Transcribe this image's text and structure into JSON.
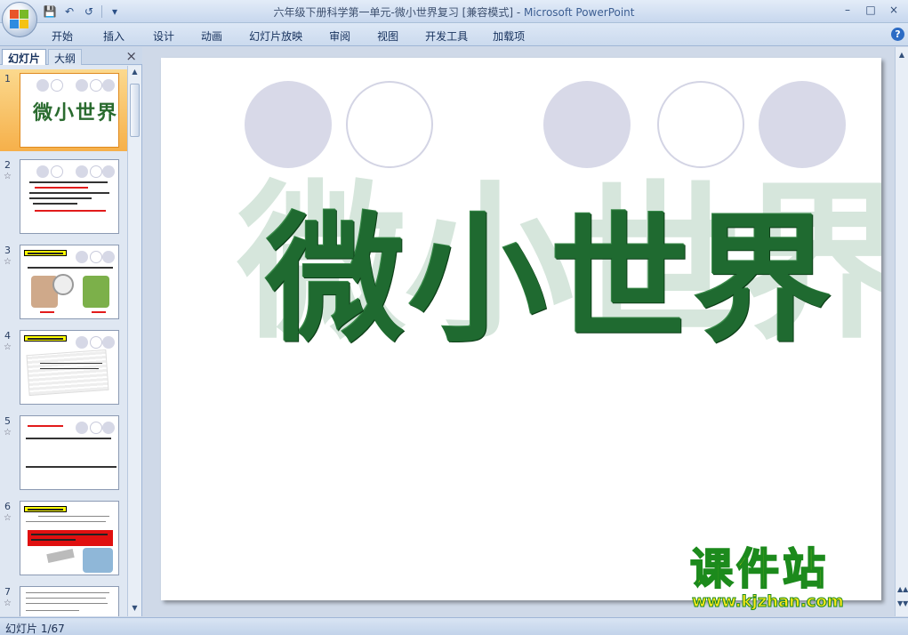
{
  "window": {
    "title_doc": "六年级下册科学第一单元-微小世界复习 [兼容模式] - ",
    "title_app": "Microsoft PowerPoint",
    "controls": [
      "–",
      "□",
      "×"
    ]
  },
  "quick_access": {
    "icons": [
      "save-icon",
      "undo-icon",
      "redo-icon",
      "customize-icon"
    ]
  },
  "ribbon": {
    "tabs": [
      "开始",
      "插入",
      "设计",
      "动画",
      "幻灯片放映",
      "审阅",
      "视图",
      "开发工具",
      "加载项"
    ],
    "help": "?"
  },
  "panel": {
    "tab_slides": "幻灯片",
    "tab_outline": "大纲",
    "close": "×"
  },
  "thumbnails": [
    {
      "num": "1",
      "title": "微小世界"
    },
    {
      "num": "2"
    },
    {
      "num": "3"
    },
    {
      "num": "4"
    },
    {
      "num": "5"
    },
    {
      "num": "6"
    },
    {
      "num": "7"
    }
  ],
  "slide": {
    "title": "微小世界",
    "ghost_title": "微小世界"
  },
  "watermark": {
    "name": "课件站",
    "url": "www.kjzhan.com"
  },
  "status": {
    "slide_indicator": "幻灯片 1/67"
  },
  "colors": {
    "accent": "#1f6a30",
    "selection": "#f6b04a"
  }
}
